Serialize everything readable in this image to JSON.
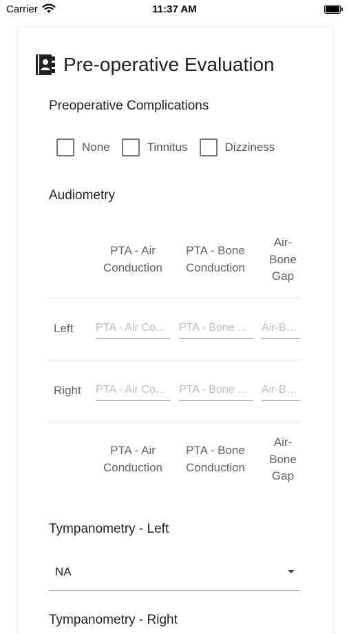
{
  "status_bar": {
    "carrier": "Carrier",
    "time": "11:37 AM"
  },
  "header": {
    "title": "Pre-operative Evaluation",
    "icon": "contact-book-icon"
  },
  "complications": {
    "label": "Preoperative Complications",
    "options": [
      {
        "label": "None",
        "checked": false
      },
      {
        "label": "Tinnitus",
        "checked": false
      },
      {
        "label": "Dizziness",
        "checked": false
      }
    ]
  },
  "audiometry": {
    "label": "Audiometry",
    "columns": [
      {
        "line1": "PTA - Air",
        "line2": "Conduction",
        "line3": ""
      },
      {
        "line1": "PTA - Bone",
        "line2": "Conduction",
        "line3": ""
      },
      {
        "line1": "Air-",
        "line2": "Bone",
        "line3": "Gap"
      }
    ],
    "rows": [
      {
        "label": "Left",
        "values": [
          "",
          "",
          ""
        ]
      },
      {
        "label": "Right",
        "values": [
          "",
          "",
          ""
        ]
      }
    ],
    "placeholders": [
      "PTA - Air Co...",
      "PTA - Bone ...",
      "Air-Bo..."
    ]
  },
  "tympanometry_left": {
    "label": "Tympanometry - Left",
    "selected": "NA"
  },
  "tympanometry_right": {
    "label": "Tympanometry - Right"
  }
}
